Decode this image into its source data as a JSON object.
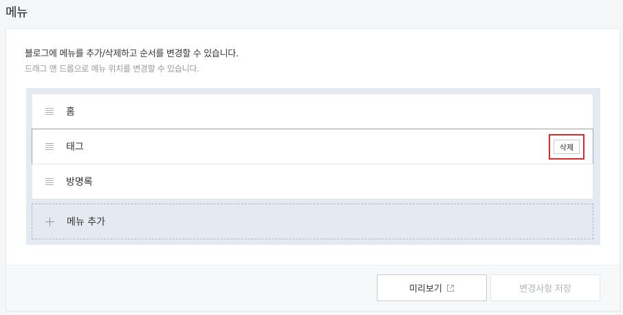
{
  "page": {
    "title": "메뉴"
  },
  "description": {
    "primary": "블로그에 메뉴를 추가/삭제하고 순서를 변경할 수 있습니다.",
    "secondary": "드래그 앤 드롭으로 메뉴 위치를 변경할 수 있습니다."
  },
  "menu": {
    "items": [
      {
        "label": "홈"
      },
      {
        "label": "태그",
        "delete_label": "삭제"
      },
      {
        "label": "방명록"
      }
    ],
    "add_label": "메뉴 추가"
  },
  "footer": {
    "preview_label": "미리보기",
    "save_label": "변경사항 저장"
  },
  "icons": {
    "drag_handle": "drag-handle-icon",
    "add": "plus-icon",
    "preview": "external-link-icon"
  },
  "colors": {
    "highlight": "#d72828",
    "menu_area_bg": "#e5e9f2"
  }
}
